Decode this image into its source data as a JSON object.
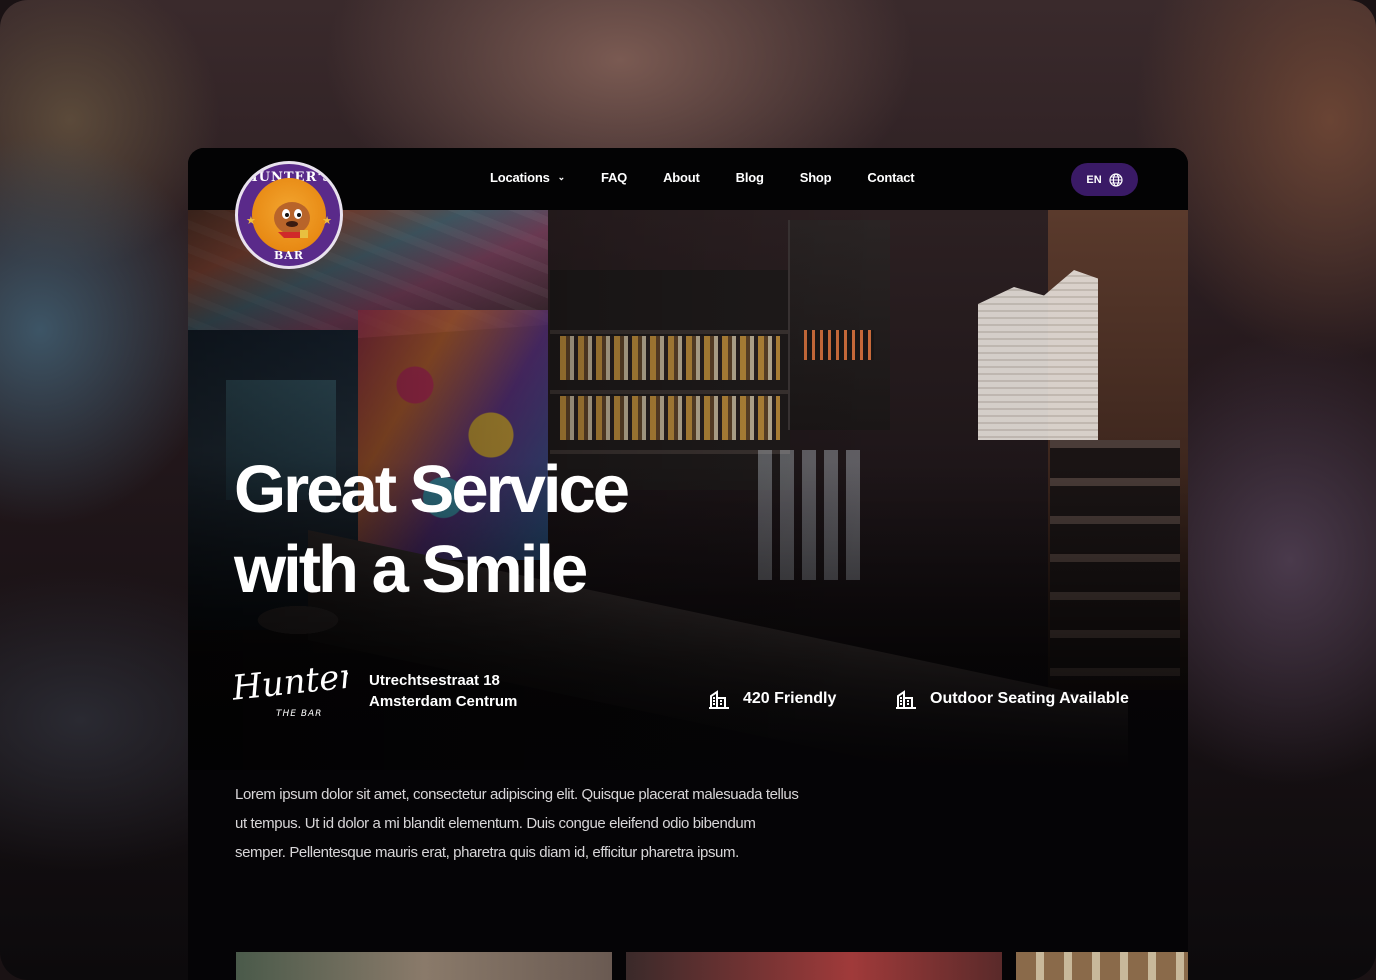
{
  "nav": {
    "logo": {
      "top_text": "HUNTER'S",
      "bottom_text": "BAR"
    },
    "links": [
      {
        "label": "Locations",
        "has_dropdown": true,
        "icon": "chevron-down-icon"
      },
      {
        "label": "FAQ"
      },
      {
        "label": "About"
      },
      {
        "label": "Blog"
      },
      {
        "label": "Shop"
      },
      {
        "label": "Contact"
      }
    ],
    "language": {
      "label": "EN",
      "icon": "globe-icon"
    }
  },
  "hero": {
    "title_line1": "Great Service",
    "title_line2": "with a Smile",
    "brand_script": "Hunter's",
    "brand_sub": "THE BAR",
    "address_line1": "Utrechtsestraat 18",
    "address_line2": "Amsterdam Centrum",
    "features": [
      {
        "label": "420 Friendly",
        "icon": "building-icon"
      },
      {
        "label": "Outdoor Seating Available",
        "icon": "building-icon"
      }
    ]
  },
  "intro": {
    "text": "Lorem ipsum dolor sit amet, consectetur adipiscing elit. Quisque placerat malesuada tellus ut tempus. Ut id dolor a mi blandit elementum. Duis congue eleifend odio bibendum semper. Pellentesque mauris erat, pharetra quis diam id, efficitur pharetra ipsum."
  },
  "colors": {
    "accent": "#3a1a66",
    "logo_purple": "#5a2a8a",
    "logo_orange": "#e88a14",
    "page_bg": "#030304"
  }
}
